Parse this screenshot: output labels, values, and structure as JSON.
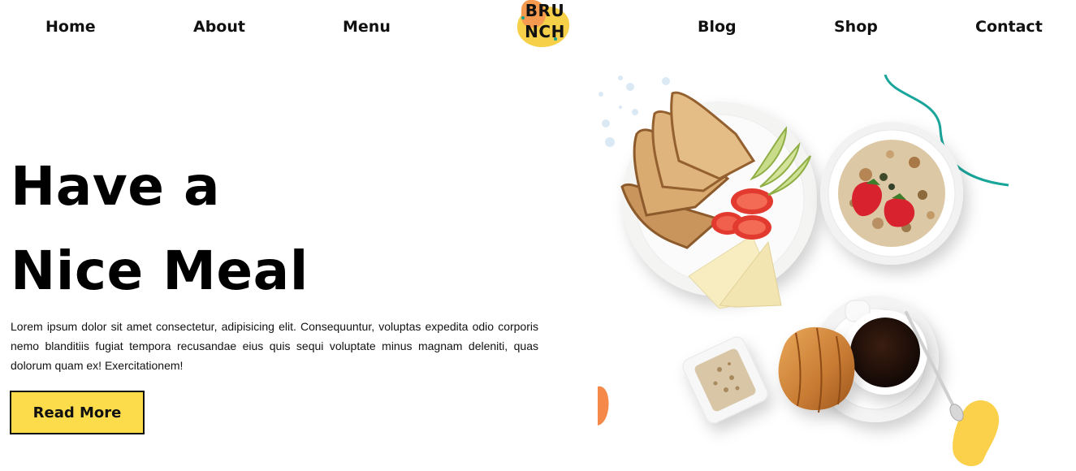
{
  "nav": {
    "items": [
      "Home",
      "About",
      "Menu",
      "Blog",
      "Shop",
      "Contact"
    ]
  },
  "logo": {
    "line1": "BRU",
    "line2": "NCH"
  },
  "hero": {
    "title_line1": "Have a",
    "title_line2": "Nice Meal",
    "body": "Lorem ipsum dolor sit amet consectetur, adipisicing elit. Consequuntur, voluptas expedita odio corporis nemo blanditiis fugiat tempora recusandae eius quis sequi voluptate minus magnam deleniti, quas dolorum quam ex! Exercitationem!",
    "button_label": "Read More"
  },
  "colors": {
    "accent_yellow": "#fcdc4a",
    "accent_orange": "#f5894a",
    "accent_teal": "#1aa59a"
  }
}
